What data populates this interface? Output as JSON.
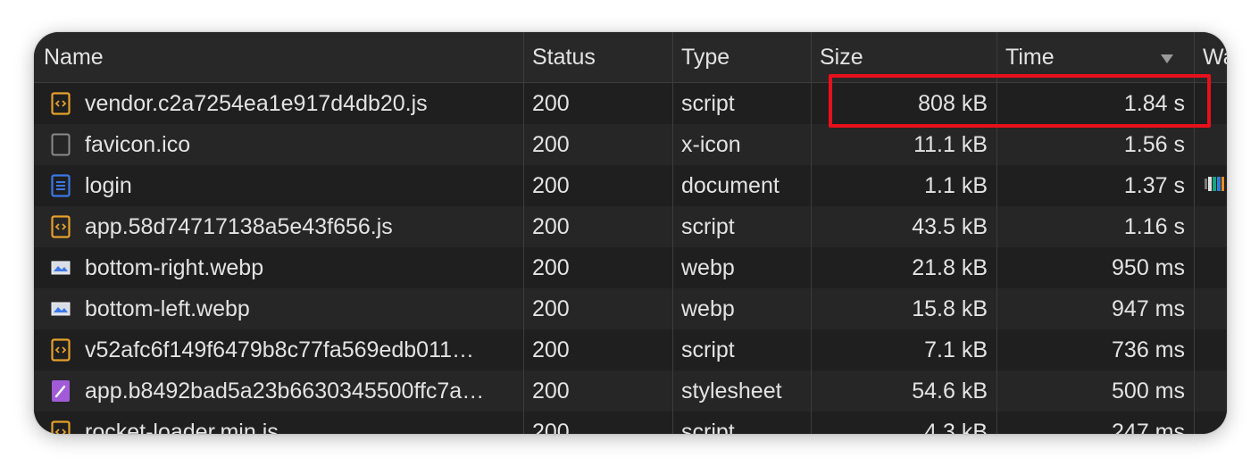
{
  "columns": {
    "name": "Name",
    "status": "Status",
    "type": "Type",
    "size": "Size",
    "time": "Time",
    "waterfall": "Wa"
  },
  "sort": {
    "column": "Time",
    "direction": "descending"
  },
  "colors": {
    "background": "#1f1f1f",
    "header": "#282828",
    "highlight": "#e8101c",
    "script_icon": "#e5a12b",
    "document_icon": "#3b78e7",
    "stylesheet_icon": "#a15bd8"
  },
  "rows": [
    {
      "name": "vendor.c2a7254ea1e917d4db20.js",
      "status": "200",
      "type": "script",
      "size": "808 kB",
      "time": "1.84 s",
      "icon": "script-icon"
    },
    {
      "name": "favicon.ico",
      "status": "200",
      "type": "x-icon",
      "size": "11.1 kB",
      "time": "1.56 s",
      "icon": "blank-file-icon"
    },
    {
      "name": "login",
      "status": "200",
      "type": "document",
      "size": "1.1 kB",
      "time": "1.37 s",
      "icon": "document-icon"
    },
    {
      "name": "app.58d74717138a5e43f656.js",
      "status": "200",
      "type": "script",
      "size": "43.5 kB",
      "time": "1.16 s",
      "icon": "script-icon"
    },
    {
      "name": "bottom-right.webp",
      "status": "200",
      "type": "webp",
      "size": "21.8 kB",
      "time": "950 ms",
      "icon": "image-icon"
    },
    {
      "name": "bottom-left.webp",
      "status": "200",
      "type": "webp",
      "size": "15.8 kB",
      "time": "947 ms",
      "icon": "image-icon"
    },
    {
      "name": "v52afc6f149f6479b8c77fa569edb011…",
      "status": "200",
      "type": "script",
      "size": "7.1 kB",
      "time": "736 ms",
      "icon": "script-icon"
    },
    {
      "name": "app.b8492bad5a23b6630345500ffc7a…",
      "status": "200",
      "type": "stylesheet",
      "size": "54.6 kB",
      "time": "500 ms",
      "icon": "stylesheet-icon"
    },
    {
      "name": "rocket-loader.min.js",
      "status": "200",
      "type": "script",
      "size": "4.3 kB",
      "time": "247 ms",
      "icon": "script-icon"
    }
  ]
}
